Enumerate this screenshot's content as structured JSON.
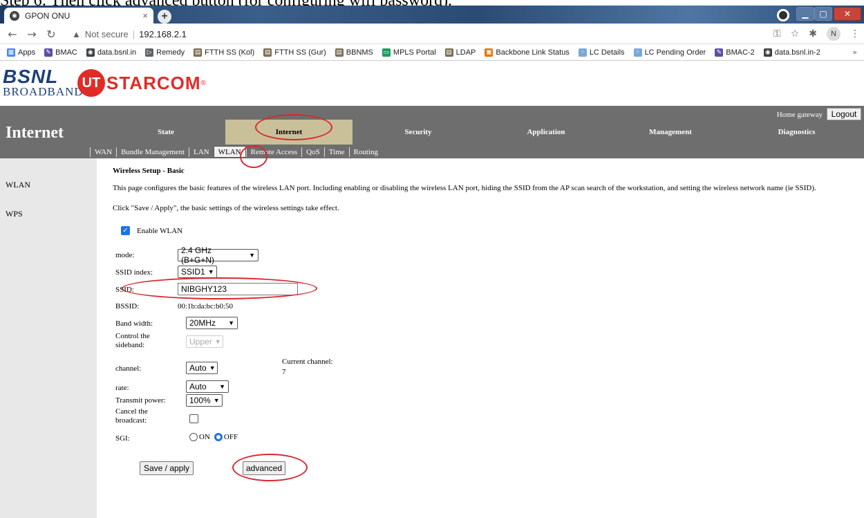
{
  "caption": "Step 6: Then click advanced button (for configuring wifi password).",
  "browser": {
    "tab_title": "GPON ONU",
    "tab_close": "×",
    "new_tab": "+",
    "security_label": "Not secure",
    "url": "192.168.2.1",
    "profile_initial": "N"
  },
  "bookmarks": [
    {
      "label": "Apps",
      "color": "#4285f4",
      "glyph": "▦"
    },
    {
      "label": "BMAC",
      "color": "#5b4fa3",
      "glyph": "✎"
    },
    {
      "label": "data.bsnl.in",
      "color": "#3c4043",
      "glyph": "◉"
    },
    {
      "label": "Remedy",
      "color": "#5f6368",
      "glyph": "▷"
    },
    {
      "label": "FTTH SS (Kol)",
      "color": "#7a6a4f",
      "glyph": "▤"
    },
    {
      "label": "FTTH SS (Gur)",
      "color": "#7a6a4f",
      "glyph": "▤"
    },
    {
      "label": "BBNMS",
      "color": "#7a6a4f",
      "glyph": "▤"
    },
    {
      "label": "MPLS Portal",
      "color": "#1a9c60",
      "glyph": "▭"
    },
    {
      "label": "LDAP",
      "color": "#7a6a4f",
      "glyph": "▤"
    },
    {
      "label": "Backbone Link Status",
      "color": "#e37400",
      "glyph": "▣"
    },
    {
      "label": "LC Details",
      "color": "#7aa7d9",
      "glyph": "⁘"
    },
    {
      "label": "LC Pending Order",
      "color": "#7aa7d9",
      "glyph": "⁘"
    },
    {
      "label": "BMAC-2",
      "color": "#5b4fa3",
      "glyph": "✎"
    },
    {
      "label": "data.bsnl.in-2",
      "color": "#3c4043",
      "glyph": "◉"
    }
  ],
  "bookmarks_more": "»",
  "logos": {
    "bsnl_top": "BSNL",
    "bsnl_bottom": "BROADBAND",
    "ut_circle": "UT",
    "ut_text": "STARCOM",
    "ut_mark": "®"
  },
  "nav": {
    "home_gateway": "Home gateway",
    "logout": "Logout",
    "section_title": "Internet",
    "tabs": [
      "State",
      "Internet",
      "Security",
      "Application",
      "Management",
      "Diagnostics"
    ],
    "subtabs": [
      "WAN",
      "Bundle Management",
      "LAN",
      "WLAN",
      "Remote Access",
      "QoS",
      "Time",
      "Routing"
    ]
  },
  "sidebar": {
    "items": [
      "WLAN",
      "WPS"
    ]
  },
  "content": {
    "heading": "Wireless Setup - Basic",
    "desc1": "This page configures the basic features of the wireless LAN port. Including enabling or disabling the wireless LAN port, hiding the SSID from the AP scan search of the workstation, and setting the wireless network name (ie SSID).",
    "desc2": "Click \"Save / Apply\", the basic settings of the wireless settings take effect.",
    "enable_wlan_label": "Enable WLAN",
    "mode_label": "mode:",
    "mode_value": "2.4 GHz (B+G+N)",
    "ssid_index_label": "SSID index:",
    "ssid_index_value": "SSID1",
    "ssid_label": "SSID:",
    "ssid_value": "NIBGHY123",
    "bssid_label": "BSSID:",
    "bssid_value": "00:1b:da:bc:b0:50",
    "bandwidth_label": "Band width:",
    "bandwidth_value": "20MHz",
    "sideband_label": "Control the sideband:",
    "sideband_value": "Upper",
    "channel_label": "channel:",
    "channel_value": "Auto",
    "current_channel_label": "Current channel:",
    "current_channel_value": "7",
    "rate_label": "rate:",
    "rate_value": "Auto",
    "tx_power_label": "Transmit power:",
    "tx_power_value": "100%",
    "cancel_broadcast_label": "Cancel the broadcast:",
    "sgi_label": "SGI:",
    "sgi_on": "ON",
    "sgi_off": "OFF",
    "save_button": "Save / apply",
    "advanced_button": "advanced"
  },
  "colors": {
    "nav_bg": "#6e6e6e",
    "active_tab": "#c9c09a",
    "annotation": "#d8282f",
    "checkbox": "#1a73e8"
  }
}
